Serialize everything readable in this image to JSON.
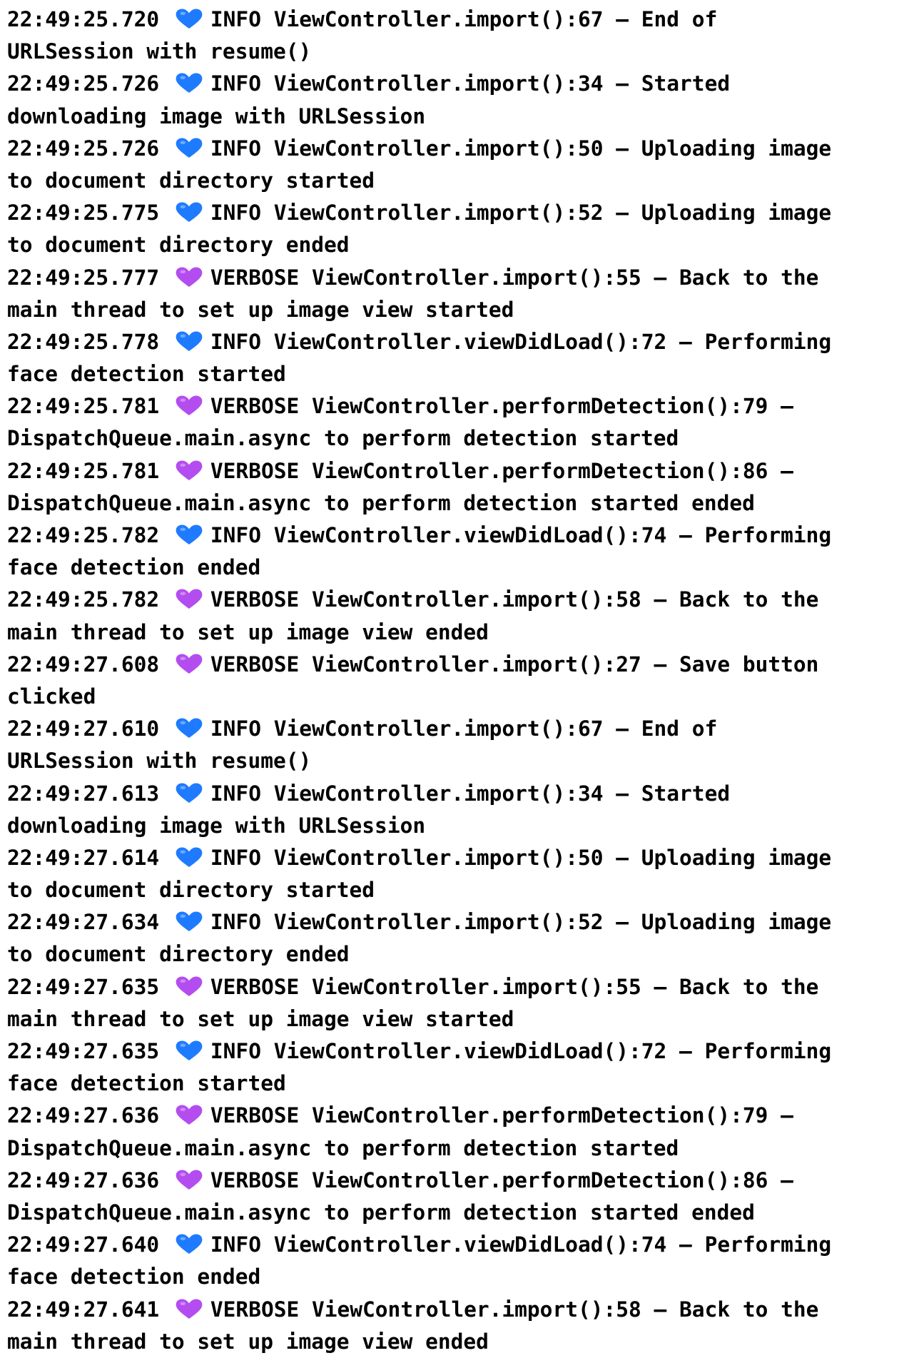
{
  "colors": {
    "info": "#1E7BFF",
    "verbose": "#B44DF0",
    "text": "#000000",
    "background": "#FFFFFF"
  },
  "entries": [
    {
      "level": "info",
      "icon": "blue-heart-icon",
      "ts": "22:49:25.720",
      "a": "INFO ViewController.import():67 – End of",
      "b": "URLSession with resume()"
    },
    {
      "level": "info",
      "icon": "blue-heart-icon",
      "ts": "22:49:25.726",
      "a": "INFO ViewController.import():34 – Started",
      "b": "downloading image with URLSession"
    },
    {
      "level": "info",
      "icon": "blue-heart-icon",
      "ts": "22:49:25.726",
      "a": "INFO ViewController.import():50 – Uploading image",
      "b": "to document directory started"
    },
    {
      "level": "info",
      "icon": "blue-heart-icon",
      "ts": "22:49:25.775",
      "a": "INFO ViewController.import():52 – Uploading image",
      "b": "to document directory ended"
    },
    {
      "level": "verbose",
      "icon": "purple-heart-icon",
      "ts": "22:49:25.777",
      "a": "VERBOSE ViewController.import():55 – Back to the",
      "b": "main thread to set up image view started"
    },
    {
      "level": "info",
      "icon": "blue-heart-icon",
      "ts": "22:49:25.778",
      "a": "INFO ViewController.viewDidLoad():72 – Performing",
      "b": "face detection started"
    },
    {
      "level": "verbose",
      "icon": "purple-heart-icon",
      "ts": "22:49:25.781",
      "a": "VERBOSE ViewController.performDetection():79 –",
      "b": "DispatchQueue.main.async to perform detection started"
    },
    {
      "level": "verbose",
      "icon": "purple-heart-icon",
      "ts": "22:49:25.781",
      "a": "VERBOSE ViewController.performDetection():86 –",
      "b": "DispatchQueue.main.async to perform detection started ended"
    },
    {
      "level": "info",
      "icon": "blue-heart-icon",
      "ts": "22:49:25.782",
      "a": "INFO ViewController.viewDidLoad():74 – Performing",
      "b": "face detection ended"
    },
    {
      "level": "verbose",
      "icon": "purple-heart-icon",
      "ts": "22:49:25.782",
      "a": "VERBOSE ViewController.import():58 – Back to the",
      "b": "main thread to set up image view ended"
    },
    {
      "level": "verbose",
      "icon": "purple-heart-icon",
      "ts": "22:49:27.608",
      "a": "VERBOSE ViewController.import():27 – Save button",
      "b": "clicked"
    },
    {
      "level": "info",
      "icon": "blue-heart-icon",
      "ts": "22:49:27.610",
      "a": "INFO ViewController.import():67 – End of",
      "b": "URLSession with resume()"
    },
    {
      "level": "info",
      "icon": "blue-heart-icon",
      "ts": "22:49:27.613",
      "a": "INFO ViewController.import():34 – Started",
      "b": "downloading image with URLSession"
    },
    {
      "level": "info",
      "icon": "blue-heart-icon",
      "ts": "22:49:27.614",
      "a": "INFO ViewController.import():50 – Uploading image",
      "b": "to document directory started"
    },
    {
      "level": "info",
      "icon": "blue-heart-icon",
      "ts": "22:49:27.634",
      "a": "INFO ViewController.import():52 – Uploading image",
      "b": "to document directory ended"
    },
    {
      "level": "verbose",
      "icon": "purple-heart-icon",
      "ts": "22:49:27.635",
      "a": "VERBOSE ViewController.import():55 – Back to the",
      "b": "main thread to set up image view started"
    },
    {
      "level": "info",
      "icon": "blue-heart-icon",
      "ts": "22:49:27.635",
      "a": "INFO ViewController.viewDidLoad():72 – Performing",
      "b": "face detection started"
    },
    {
      "level": "verbose",
      "icon": "purple-heart-icon",
      "ts": "22:49:27.636",
      "a": "VERBOSE ViewController.performDetection():79 –",
      "b": "DispatchQueue.main.async to perform detection started"
    },
    {
      "level": "verbose",
      "icon": "purple-heart-icon",
      "ts": "22:49:27.636",
      "a": "VERBOSE ViewController.performDetection():86 –",
      "b": "DispatchQueue.main.async to perform detection started ended"
    },
    {
      "level": "info",
      "icon": "blue-heart-icon",
      "ts": "22:49:27.640",
      "a": "INFO ViewController.viewDidLoad():74 – Performing",
      "b": "face detection ended"
    },
    {
      "level": "verbose",
      "icon": "purple-heart-icon",
      "ts": "22:49:27.641",
      "a": "VERBOSE ViewController.import():58 – Back to the",
      "b": "main thread to set up image view ended"
    }
  ]
}
